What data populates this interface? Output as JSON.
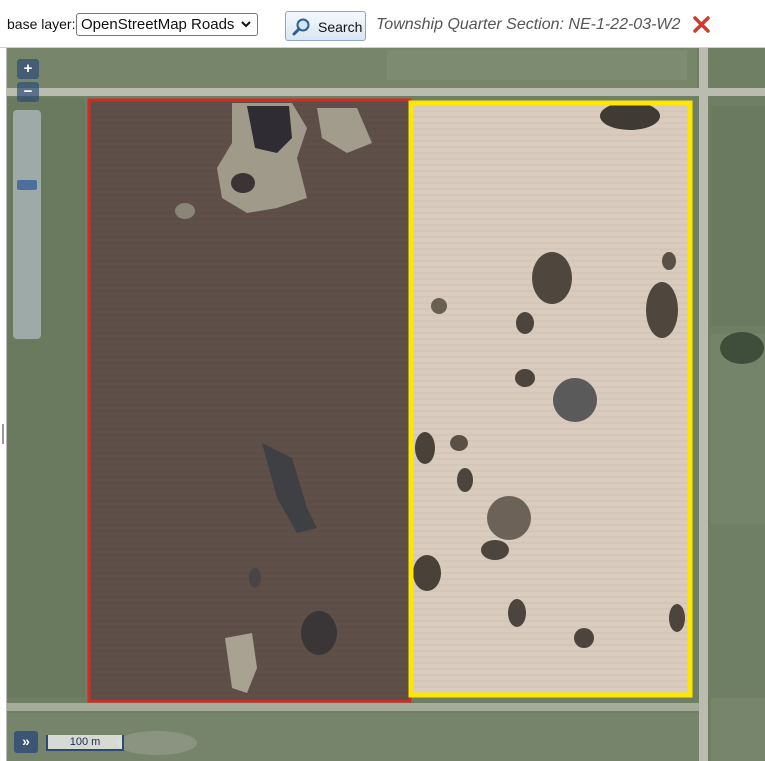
{
  "toolbar": {
    "base_layer_label": "base layer:",
    "base_layer_value": "OpenStreetMap Roads",
    "search_label": "Search",
    "township_label": "Township Quarter Section: NE-1-22-03-W2",
    "close_icon": "close-icon",
    "search_icon": "magnifier-icon"
  },
  "map": {
    "zoom_in_label": "+",
    "zoom_out_label": "−",
    "expand_label": "»",
    "scale_label": "100 m",
    "colors": {
      "outline_left": "#d42a24",
      "outline_right": "#ffe600",
      "field_dark": "#5e5049",
      "field_light": "#d9cbbd",
      "grass": "#6f7f63",
      "road": "#b9bcae"
    }
  }
}
